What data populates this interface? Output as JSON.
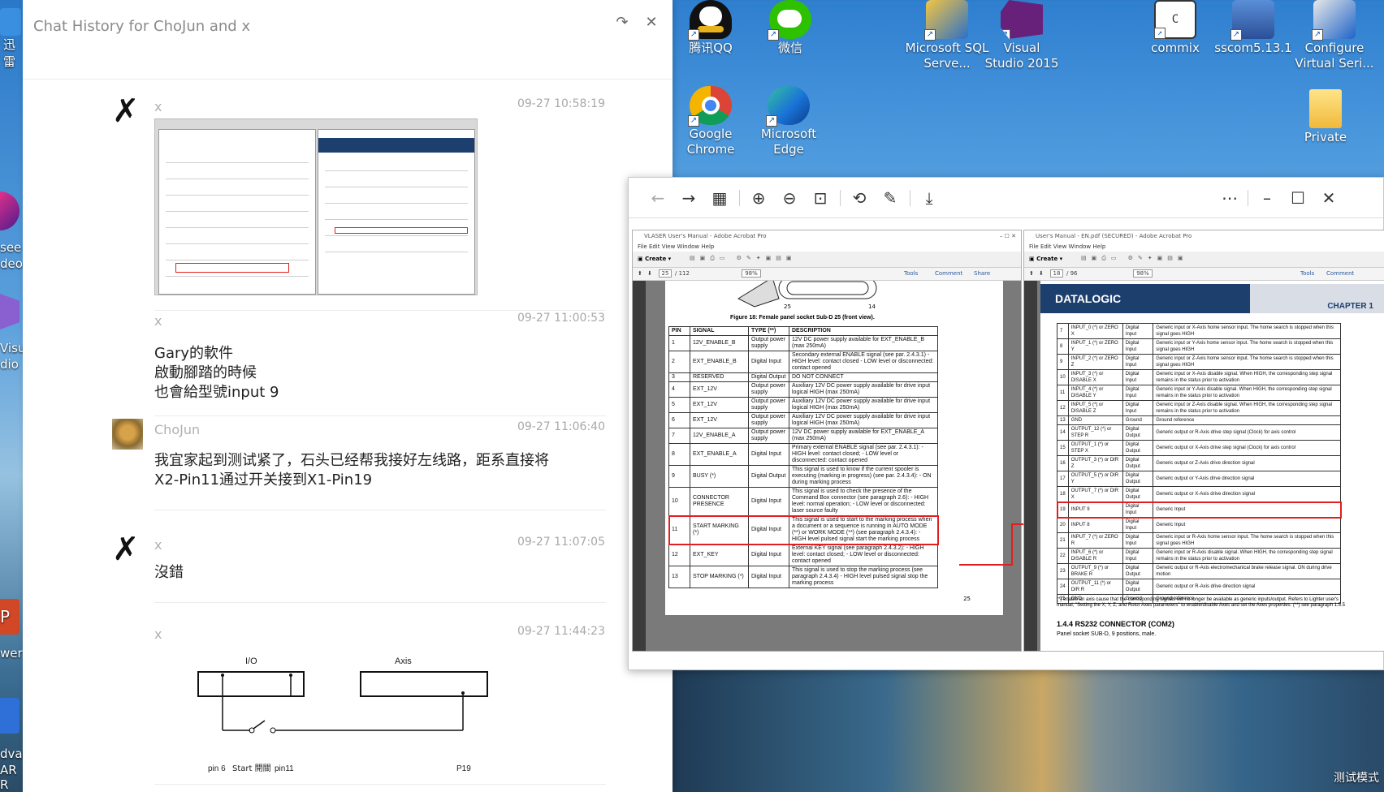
{
  "chat": {
    "title": "Chat History for ChoJun and x",
    "messages": [
      {
        "sender": "x",
        "time": "09-27 10:58:19",
        "text": ""
      },
      {
        "sender": "x",
        "time": "09-27 11:00:53",
        "text": "Gary的軟件\n啟動腳踏的時候\n也會給型號input 9"
      },
      {
        "sender": "ChoJun",
        "time": "09-27 11:06:40",
        "text": "我宜家起到测试紧了，石头已经帮我接好左线路，距系直接将\nX2-Pin11通过开关接到X1-Pin19"
      },
      {
        "sender": "x",
        "time": "09-27 11:07:05",
        "text": "沒錯"
      },
      {
        "sender": "x",
        "time": "09-27 11:44:23",
        "text": ""
      }
    ],
    "diagram": {
      "label_io": "I/O",
      "label_axis": "Axis",
      "pin6": "pin 6",
      "start": "Start 開關",
      "pin11": "pin11",
      "p19": "P19"
    }
  },
  "desktop": {
    "icons": [
      {
        "label": "腾讯QQ",
        "icon": "qq-icon"
      },
      {
        "label": "微信",
        "icon": "wechat-icon"
      },
      {
        "label": "Microsoft SQL Serve...",
        "icon": "sql-server-icon"
      },
      {
        "label": "Visual Studio 2015",
        "icon": "visual-studio-icon"
      },
      {
        "label": "commix",
        "icon": "commix-icon"
      },
      {
        "label": "sscom5.13.1",
        "icon": "sscom-icon"
      },
      {
        "label": "Configure Virtual Seri...",
        "icon": "configure-icon"
      },
      {
        "label": "Google Chrome",
        "icon": "chrome-icon"
      },
      {
        "label": "Microsoft Edge",
        "icon": "edge-icon"
      },
      {
        "label": "Private",
        "icon": "folder-icon"
      }
    ],
    "left_fragments": [
      "迅雷",
      "see",
      "deo",
      "Visu",
      "dio",
      "wer",
      "dvar",
      "AR R"
    ],
    "tray_text": "测试模式"
  },
  "viewer": {
    "left_doc": {
      "title": "VLASER User's Manual - Adobe Acrobat Pro",
      "menu": "File  Edit  View  Window  Help",
      "create": "Create",
      "page": "25",
      "pages": "/ 112",
      "zoom": "98%",
      "tools": "Tools",
      "comment": "Comment",
      "share": "Share",
      "figure_caption": "Figure 18: Female panel socket Sub-D 25 (front view).",
      "pin_left": "25",
      "pin_right": "14",
      "page_number": "25",
      "headers": [
        "PIN",
        "SIGNAL",
        "TYPE (**)",
        "DESCRIPTION"
      ],
      "rows": [
        [
          "1",
          "12V_ENABLE_B",
          "Output power supply",
          "12V DC power supply available for EXT_ENABLE_B (max 250mA)"
        ],
        [
          "2",
          "EXT_ENABLE_B",
          "Digital Input",
          "Secondary external ENABLE signal (see par. 2.4.3.1) - HIGH level: contact closed - LOW level or disconnected: contact opened"
        ],
        [
          "3",
          "RESERVED",
          "Digital Output",
          "DO NOT CONNECT"
        ],
        [
          "4",
          "EXT_12V",
          "Output power supply",
          "Auxiliary 12V DC power supply available for drive input logical HIGH (max 250mA)"
        ],
        [
          "5",
          "EXT_12V",
          "Output power supply",
          "Auxiliary 12V DC power supply available for drive input logical HIGH (max 250mA)"
        ],
        [
          "6",
          "EXT_12V",
          "Output power supply",
          "Auxiliary 12V DC power supply available for drive input logical HIGH (max 250mA)"
        ],
        [
          "7",
          "12V_ENABLE_A",
          "Output power supply",
          "12V DC power supply available for EXT_ENABLE_A (max 250mA)"
        ],
        [
          "8",
          "EXT_ENABLE_A",
          "Digital Input",
          "Primary external ENABLE signal (see par. 2.4.3.1): - HIGH level: contact closed; - LOW level or disconnected: contact opened"
        ],
        [
          "9",
          "BUSY (*)",
          "Digital Output",
          "This signal is used to know if the current spooler is executing (marking in progress) (see par. 2.4.3.4): - ON during marking process"
        ],
        [
          "10",
          "CONNECTOR PRESENCE",
          "Digital Input",
          "This signal is used to check the presence of the Command Box connector (see paragraph 2.6): - HIGH level: normal operation; - LOW level or disconnected: laser source faulty"
        ],
        [
          "11",
          "START MARKING (*)",
          "Digital Input",
          "This signal is used to start to the marking process when a document or a sequence is running in AUTO MODE (**) or WORK MODE (**) (see paragraph 2.4.3.4): - HIGH level pulsed signal start the marking process"
        ],
        [
          "12",
          "EXT_KEY",
          "Digital Input",
          "External KEY signal (see paragraph 2.4.3.2): - HIGH level: contact closed; - LOW level or disconnected: contact opened"
        ],
        [
          "13",
          "STOP MARKING (*)",
          "Digital Input",
          "This signal is used to stop the marking process (see paragraph 2.4.3.4) - HIGH level pulsed signal stop the marking process"
        ]
      ]
    },
    "right_doc": {
      "title": "User's Manual - EN.pdf (SECURED) - Adobe Acrobat Pro",
      "menu": "File  Edit  View  Window  Help",
      "create": "Create",
      "page": "18",
      "pages": "/ 96",
      "zoom": "98%",
      "tools": "Tools",
      "comment": "Comment",
      "brand": "DATALOGIC",
      "chapter": "CHAPTER 1",
      "rows": [
        [
          "7",
          "INPUT_0 (*) or ZERO X",
          "Digital Input",
          "Generic input or X-Axis home sensor input. The home search is stopped when this signal goes HIGH"
        ],
        [
          "8",
          "INPUT_1 (*) or ZERO Y",
          "Digital Input",
          "Generic input or Y-Axis home sensor input. The home search is stopped when this signal goes HIGH"
        ],
        [
          "9",
          "INPUT_2 (*) or ZERO Z",
          "Digital Input",
          "Generic input or Z-Axis home sensor input. The home search is stopped when this signal goes HIGH"
        ],
        [
          "10",
          "INPUT_3 (*) or DISABLE X",
          "Digital Input",
          "Generic input or X-Axis disable signal. When HIGH, the corresponding step signal remains in the status prior to activation"
        ],
        [
          "11",
          "INPUT_4 (*) or DISABLE Y",
          "Digital Input",
          "Generic input or Y-Axis disable signal. When HIGH, the corresponding step signal remains in the status prior to activation"
        ],
        [
          "12",
          "INPUT_5 (*) or DISABLE Z",
          "Digital Input",
          "Generic input or Z-Axis disable signal. When HIGH, the corresponding step signal remains in the status prior to activation"
        ],
        [
          "13",
          "GND",
          "Ground",
          "Ground reference"
        ],
        [
          "14",
          "OUTPUT_12 (*) or STEP R",
          "Digital Output",
          "Generic output or R-Axis drive step signal (Clock) for axis control"
        ],
        [
          "15",
          "OUTPUT_1 (*) or STEP X",
          "Digital Output",
          "Generic output or X-Axis drive step signal (Clock) for axis control"
        ],
        [
          "16",
          "OUTPUT_3 (*) or DIR Z",
          "Digital Output",
          "Generic output or Z-Axis drive direction signal"
        ],
        [
          "17",
          "OUTPUT_5 (*) or DIR Y",
          "Digital Output",
          "Generic output or Y-Axis drive direction signal"
        ],
        [
          "18",
          "OUTPUT_7 (*) or DIR X",
          "Digital Output",
          "Generic output or X-Axis drive direction signal"
        ],
        [
          "19",
          "INPUT 9",
          "Digital Input",
          "Generic Input"
        ],
        [
          "20",
          "INPUT 8",
          "Digital Input",
          "Generic Input"
        ],
        [
          "21",
          "INPUT_7 (*) or ZERO R",
          "Digital Input",
          "Generic input or R-Axis home sensor input. The home search is stopped when this signal goes HIGH"
        ],
        [
          "22",
          "INPUT_6 (*) or DISABLE R",
          "Digital Input",
          "Generic input or R-Axis disable signal. When HIGH, the corresponding step signal remains in the status prior to activation"
        ],
        [
          "23",
          "OUTPUT_9 (*) or BRAKE R",
          "Digital Output",
          "Generic output or R-Axis electromechanical brake release signal. ON during drive motion"
        ],
        [
          "24",
          "OUTPUT_11 (*) or DIR R",
          "Digital Output",
          "Generic output or R-Axis drive direction signal"
        ],
        [
          "25",
          "GND",
          "Ground",
          "Ground reference"
        ]
      ],
      "footnote": "(*) enable an axis cause that the corresponding signals will no longer be available as generic inputs/output. Refers to Lighter user's manual, \"Setting the X, Y, Z, and Rotor Axes parameters\" to enable/disable Axes and set the Axes properties. (**) see paragraph 1.5.5",
      "section": "1.4.4  RS232 CONNECTOR (COM2)",
      "section_sub": "Panel socket SUB-D, 9 positions, male."
    }
  }
}
